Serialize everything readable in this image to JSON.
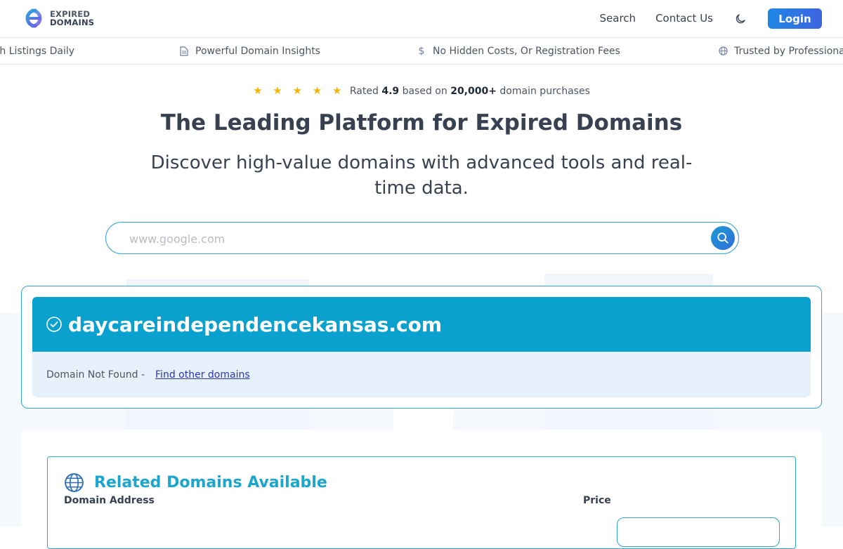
{
  "header": {
    "logo_line1": "EXPIRED",
    "logo_line2": "DOMAINS",
    "nav": [
      "Search",
      "Contact Us"
    ],
    "login_label": "Login",
    "icons": {
      "theme_toggle": "moon-icon"
    }
  },
  "features": [
    {
      "icon": "refresh-icon",
      "label": "Fresh Listings Daily"
    },
    {
      "icon": "document-icon",
      "label": "Powerful Domain Insights"
    },
    {
      "icon": "dollar-icon",
      "label": "No Hidden Costs, Or Registration Fees"
    },
    {
      "icon": "globe-icon",
      "label": "Trusted by Professionals"
    }
  ],
  "hero": {
    "stars": "★ ★ ★ ★ ★",
    "rating_prefix": "Rated",
    "rating_value": "4.9",
    "rating_mid": "based on",
    "rating_count": "20,000+",
    "rating_suffix": "domain purchases",
    "title": "The Leading Platform for Expired Domains",
    "subtitle": "Discover high-value domains with advanced tools and real-time data."
  },
  "search": {
    "placeholder": "www.google.com",
    "value": ""
  },
  "result": {
    "domain": "daycareindependencekansas.com",
    "status_text": "Domain Not Found -",
    "link_label": "Find other domains"
  },
  "related": {
    "title": "Related Domains Available",
    "col_domain": "Domain Address",
    "col_price": "Price"
  },
  "colors": {
    "accent": "#0aa1cf",
    "login_button": "#2f7be0",
    "link": "#2b35b4",
    "star": "#f5b400",
    "status_bg": "#e6f1fb"
  }
}
